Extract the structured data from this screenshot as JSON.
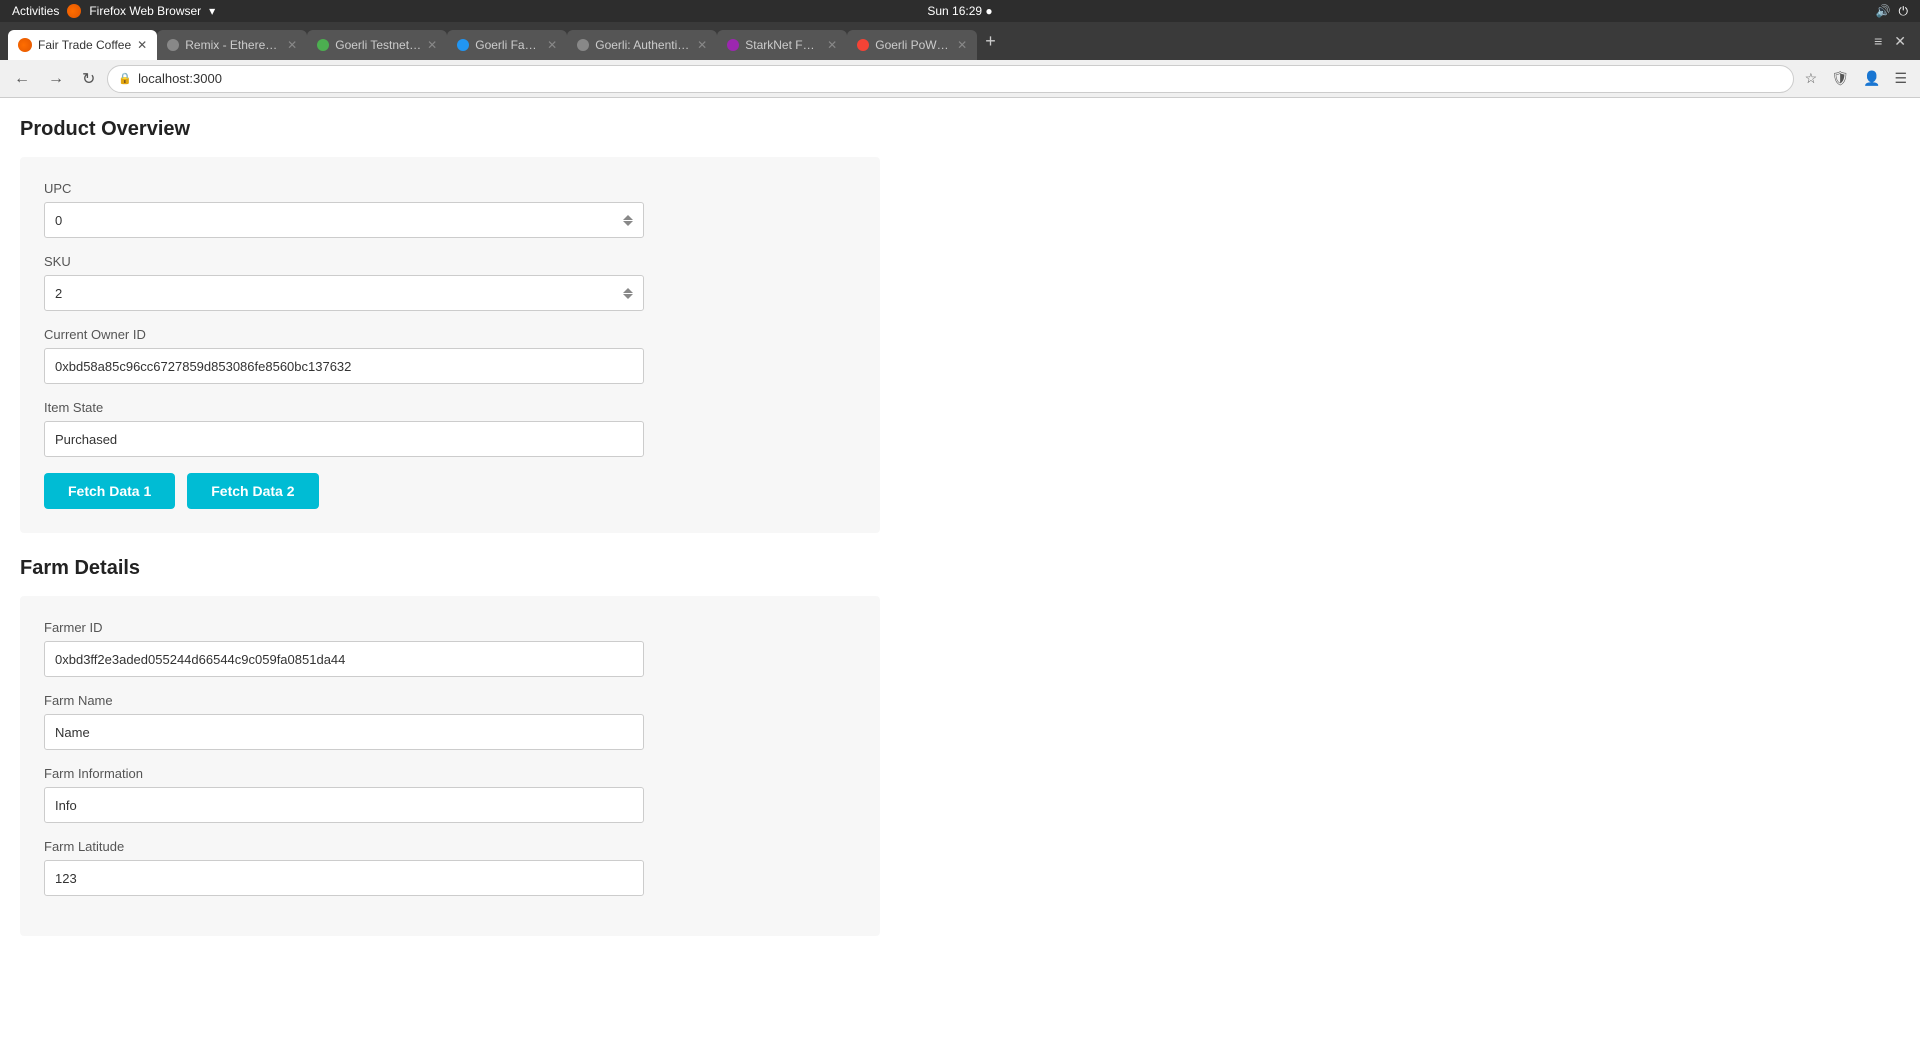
{
  "os_bar": {
    "left": "Activities",
    "browser_name": "Firefox Web Browser",
    "center": "Sun 16:29 ●",
    "right_icons": [
      "volume",
      "power"
    ]
  },
  "tabs": [
    {
      "id": "tab-1",
      "label": "Fair Trade Coffee",
      "favicon_color": "#e25600",
      "active": true
    },
    {
      "id": "tab-2",
      "label": "Remix - Ethereum IDE",
      "favicon_color": "#555",
      "active": false
    },
    {
      "id": "tab-3",
      "label": "Goerli Testnet Faucet",
      "favicon_color": "#4caf50",
      "active": false
    },
    {
      "id": "tab-4",
      "label": "Goerli Faucet",
      "favicon_color": "#2196f3",
      "active": false
    },
    {
      "id": "tab-5",
      "label": "Goerli: Authenticated Fau...",
      "favicon_color": "#555",
      "active": false
    },
    {
      "id": "tab-6",
      "label": "StarkNet Faucet",
      "favicon_color": "#9c27b0",
      "active": false
    },
    {
      "id": "tab-7",
      "label": "Goerli PoW Faucet",
      "favicon_color": "#f44336",
      "active": false
    }
  ],
  "nav": {
    "url": "localhost:3000",
    "back_label": "←",
    "forward_label": "→",
    "reload_label": "↻"
  },
  "app_title": "Fair Trade Coffee",
  "product_overview": {
    "section_title": "Product Overview",
    "card_bg": "#f7f7f7",
    "fields": [
      {
        "id": "upc",
        "label": "UPC",
        "value": "0",
        "type": "number"
      },
      {
        "id": "sku",
        "label": "SKU",
        "value": "2",
        "type": "number"
      },
      {
        "id": "current_owner_id",
        "label": "Current Owner ID",
        "value": "0xbd58a85c96cc6727859d853086fe8560bc137632",
        "type": "text"
      },
      {
        "id": "item_state",
        "label": "Item State",
        "value": "Purchased",
        "type": "text"
      }
    ],
    "buttons": [
      {
        "id": "fetch-data-1",
        "label": "Fetch Data 1"
      },
      {
        "id": "fetch-data-2",
        "label": "Fetch Data 2"
      }
    ]
  },
  "farm_details": {
    "section_title": "Farm Details",
    "fields": [
      {
        "id": "farmer_id",
        "label": "Farmer ID",
        "value": "0xbd3ff2e3aded055244d66544c9c059fa0851da44",
        "type": "text"
      },
      {
        "id": "farm_name",
        "label": "Farm Name",
        "value": "Name",
        "type": "text"
      },
      {
        "id": "farm_information",
        "label": "Farm Information",
        "value": "Info",
        "type": "text"
      },
      {
        "id": "farm_latitude",
        "label": "Farm Latitude",
        "value": "123",
        "type": "text"
      }
    ]
  }
}
